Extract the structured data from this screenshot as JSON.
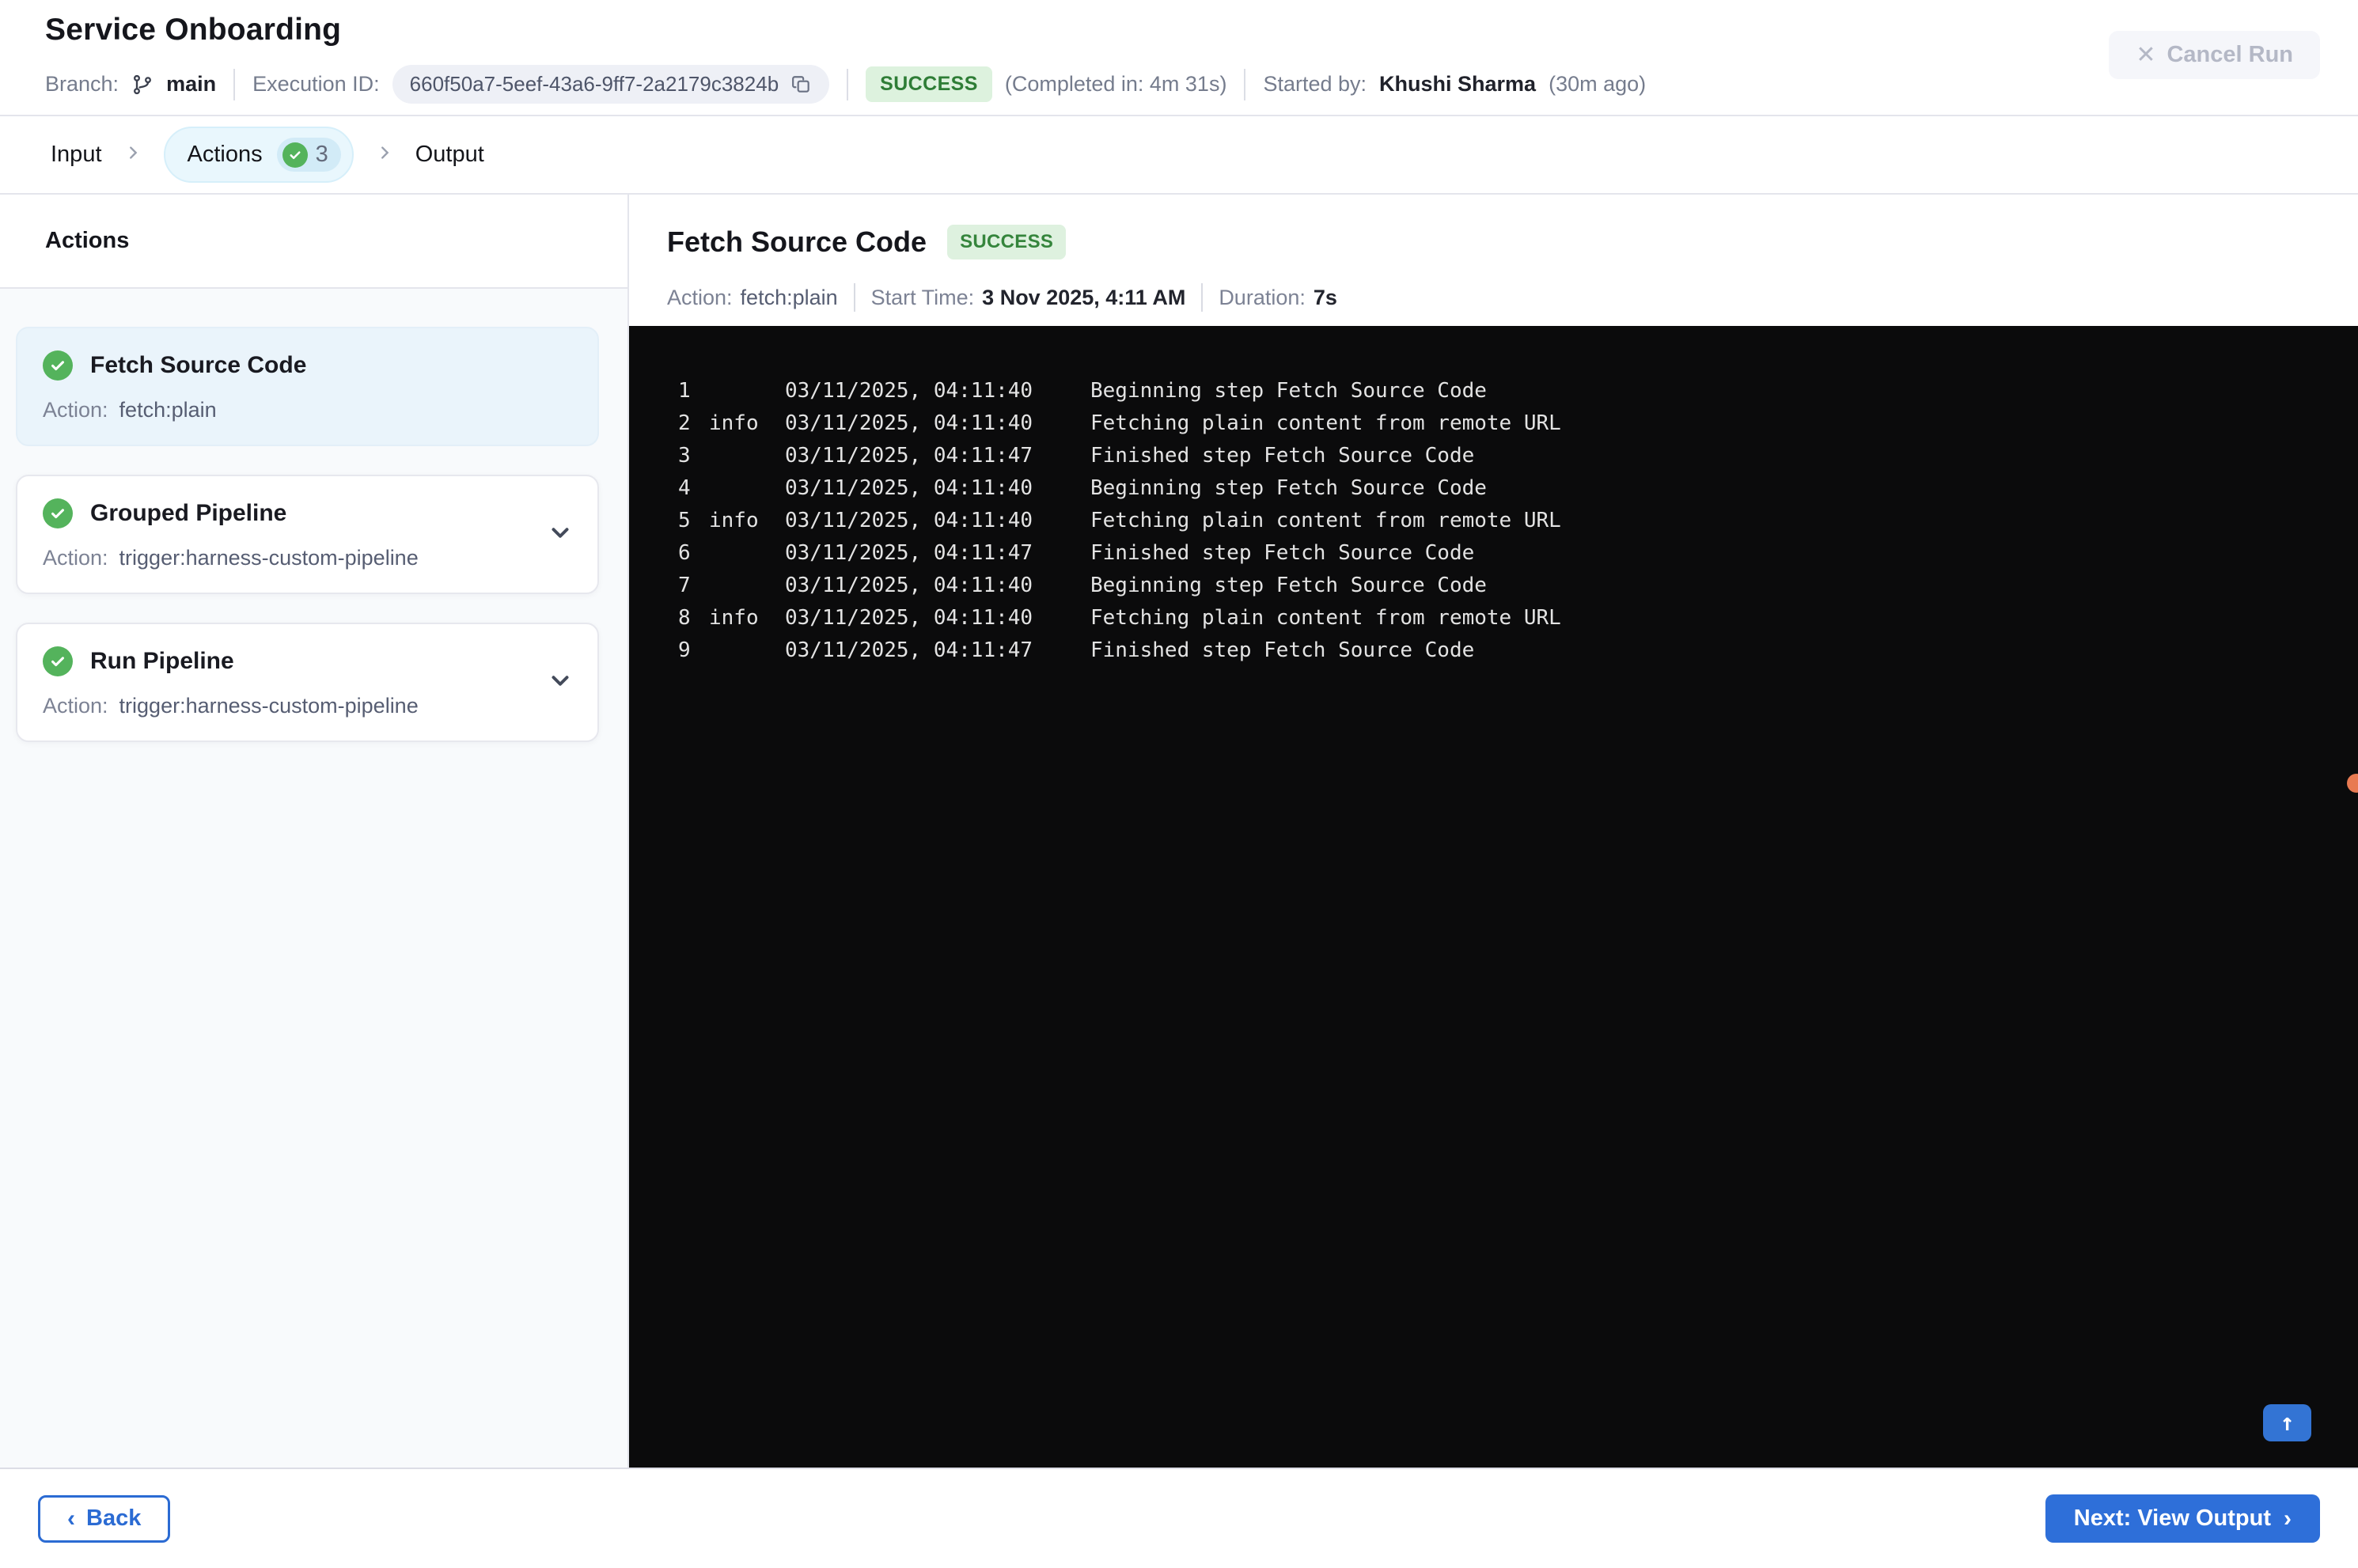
{
  "header": {
    "title": "Service Onboarding",
    "branch_label": "Branch:",
    "branch_value": "main",
    "execution_id_label": "Execution ID:",
    "execution_id": "660f50a7-5eef-43a6-9ff7-2a2179c3824b",
    "status": "SUCCESS",
    "completed_in": "(Completed in: 4m 31s)",
    "started_by_label": "Started by:",
    "started_by": "Khushi Sharma",
    "started_ago": "(30m ago)",
    "cancel_button": "Cancel Run"
  },
  "stepper": {
    "steps": [
      {
        "label": "Input",
        "active": false
      },
      {
        "label": "Actions",
        "active": true,
        "badge_count": "3"
      },
      {
        "label": "Output",
        "active": false
      }
    ]
  },
  "sidebar": {
    "heading": "Actions",
    "action_label": "Action:",
    "items": [
      {
        "title": "Fetch Source Code",
        "action": "fetch:plain",
        "status": "success",
        "selected": true,
        "expandable": false
      },
      {
        "title": "Grouped Pipeline",
        "action": "trigger:harness-custom-pipeline",
        "status": "success",
        "selected": false,
        "expandable": true
      },
      {
        "title": "Run Pipeline",
        "action": "trigger:harness-custom-pipeline",
        "status": "success",
        "selected": false,
        "expandable": true
      }
    ]
  },
  "detail": {
    "title": "Fetch Source Code",
    "status": "SUCCESS",
    "meta": [
      {
        "label": "Action:",
        "value": "fetch:plain"
      },
      {
        "label": "Start Time:",
        "value": "3 Nov 2025, 4:11 AM"
      },
      {
        "label": "Duration:",
        "value": "7s"
      }
    ]
  },
  "log": {
    "lines": [
      {
        "num": "1",
        "level": "",
        "time": "03/11/2025, 04:11:40",
        "message": "Beginning step Fetch Source Code"
      },
      {
        "num": "2",
        "level": "info",
        "time": "03/11/2025, 04:11:40",
        "message": "Fetching plain content from remote URL"
      },
      {
        "num": "3",
        "level": "",
        "time": "03/11/2025, 04:11:47",
        "message": "Finished step Fetch Source Code"
      },
      {
        "num": "4",
        "level": "",
        "time": "03/11/2025, 04:11:40",
        "message": "Beginning step Fetch Source Code"
      },
      {
        "num": "5",
        "level": "info",
        "time": "03/11/2025, 04:11:40",
        "message": "Fetching plain content from remote URL"
      },
      {
        "num": "6",
        "level": "",
        "time": "03/11/2025, 04:11:47",
        "message": "Finished step Fetch Source Code"
      },
      {
        "num": "7",
        "level": "",
        "time": "03/11/2025, 04:11:40",
        "message": "Beginning step Fetch Source Code"
      },
      {
        "num": "8",
        "level": "info",
        "time": "03/11/2025, 04:11:40",
        "message": "Fetching plain content from remote URL"
      },
      {
        "num": "9",
        "level": "",
        "time": "03/11/2025, 04:11:47",
        "message": "Finished step Fetch Source Code"
      }
    ]
  },
  "footer": {
    "back_label": "Back",
    "next_label": "Next: View Output"
  },
  "colors": {
    "accent_blue": "#2e6fd9",
    "success_green": "#54b35c",
    "success_badge_bg": "#ddf2de",
    "success_badge_text": "#2e7d36",
    "active_tab_bg": "#e9f7fd",
    "selected_card_bg": "#eaf4fb",
    "console_bg": "#0b0b0c",
    "floating_dot_orange": "#e87a52"
  }
}
